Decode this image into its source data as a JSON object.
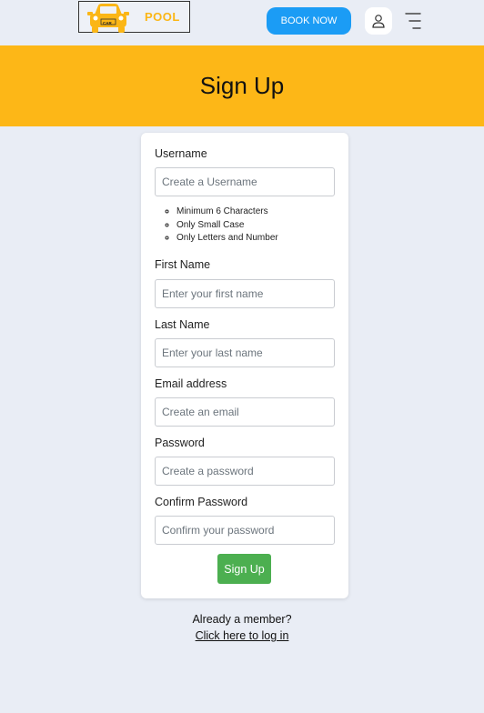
{
  "header": {
    "logo_text": "POOL",
    "logo_badge": "CAR",
    "book_now_label": "BOOK NOW",
    "accent_color": "#fdb717",
    "book_color": "#1b9cf5",
    "icons": [
      "car-logo-icon",
      "user-icon",
      "menu-icon"
    ]
  },
  "banner": {
    "title": "Sign Up"
  },
  "form": {
    "username": {
      "label": "Username",
      "placeholder": "Create a Username",
      "rules": [
        "Minimum 6 Characters",
        "Only Small Case",
        "Only Letters and Number"
      ]
    },
    "first_name": {
      "label": "First Name",
      "placeholder": "Enter your first name"
    },
    "last_name": {
      "label": "Last Name",
      "placeholder": "Enter your last name"
    },
    "email": {
      "label": "Email address",
      "placeholder": "Create an email"
    },
    "password": {
      "label": "Password",
      "placeholder": "Create a password"
    },
    "confirm_password": {
      "label": "Confirm Password",
      "placeholder": "Confirm your password"
    },
    "submit_label": "Sign Up",
    "submit_color": "#4caf50"
  },
  "footer": {
    "member_text": "Already a member?",
    "login_link": "Click here to log in"
  }
}
